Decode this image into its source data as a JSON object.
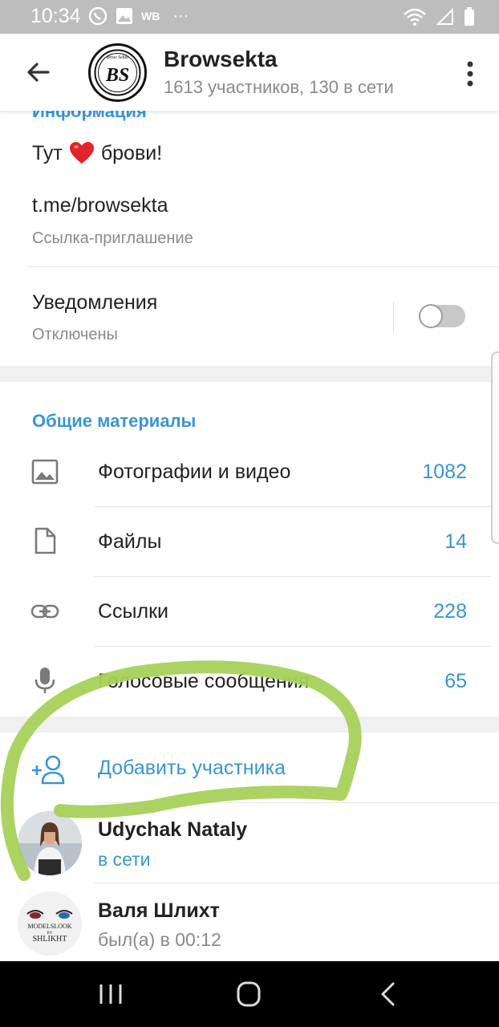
{
  "status_bar": {
    "time": "10:34",
    "wb_label": "WB",
    "more": "···"
  },
  "header": {
    "title": "Browsekta",
    "subtitle": "1613 участников, 130 в сети",
    "avatar_text": "BS",
    "avatar_top_text": "Brow Sekta"
  },
  "info": {
    "section_title": "Информация",
    "description_before": "Тут",
    "description_after": "брови!",
    "link": "t.me/browsekta",
    "link_caption": "Ссылка-приглашение",
    "notifications_label": "Уведомления",
    "notifications_value": "Отключены",
    "notifications_enabled": false
  },
  "shared": {
    "section_title": "Общие материалы",
    "items": [
      {
        "label": "Фотографии и видео",
        "count": "1082",
        "icon": "image-icon"
      },
      {
        "label": "Файлы",
        "count": "14",
        "icon": "file-icon"
      },
      {
        "label": "Ссылки",
        "count": "228",
        "icon": "link-icon"
      },
      {
        "label": "Голосовые сообщения",
        "count": "65",
        "icon": "mic-icon"
      }
    ]
  },
  "members": {
    "add_label": "Добавить участника",
    "list": [
      {
        "name": "Udychak Nataly",
        "status": "в сети",
        "online": true
      },
      {
        "name": "Валя Шлихт",
        "status": "был(а) в 00:12",
        "online": false,
        "avatar_text_1": "MODELSLOOK",
        "avatar_text_2": "BY",
        "avatar_text_3": "SHLIKHT"
      }
    ]
  },
  "colors": {
    "accent": "#3a95d5",
    "highlight_stroke": "#a6d15a"
  }
}
